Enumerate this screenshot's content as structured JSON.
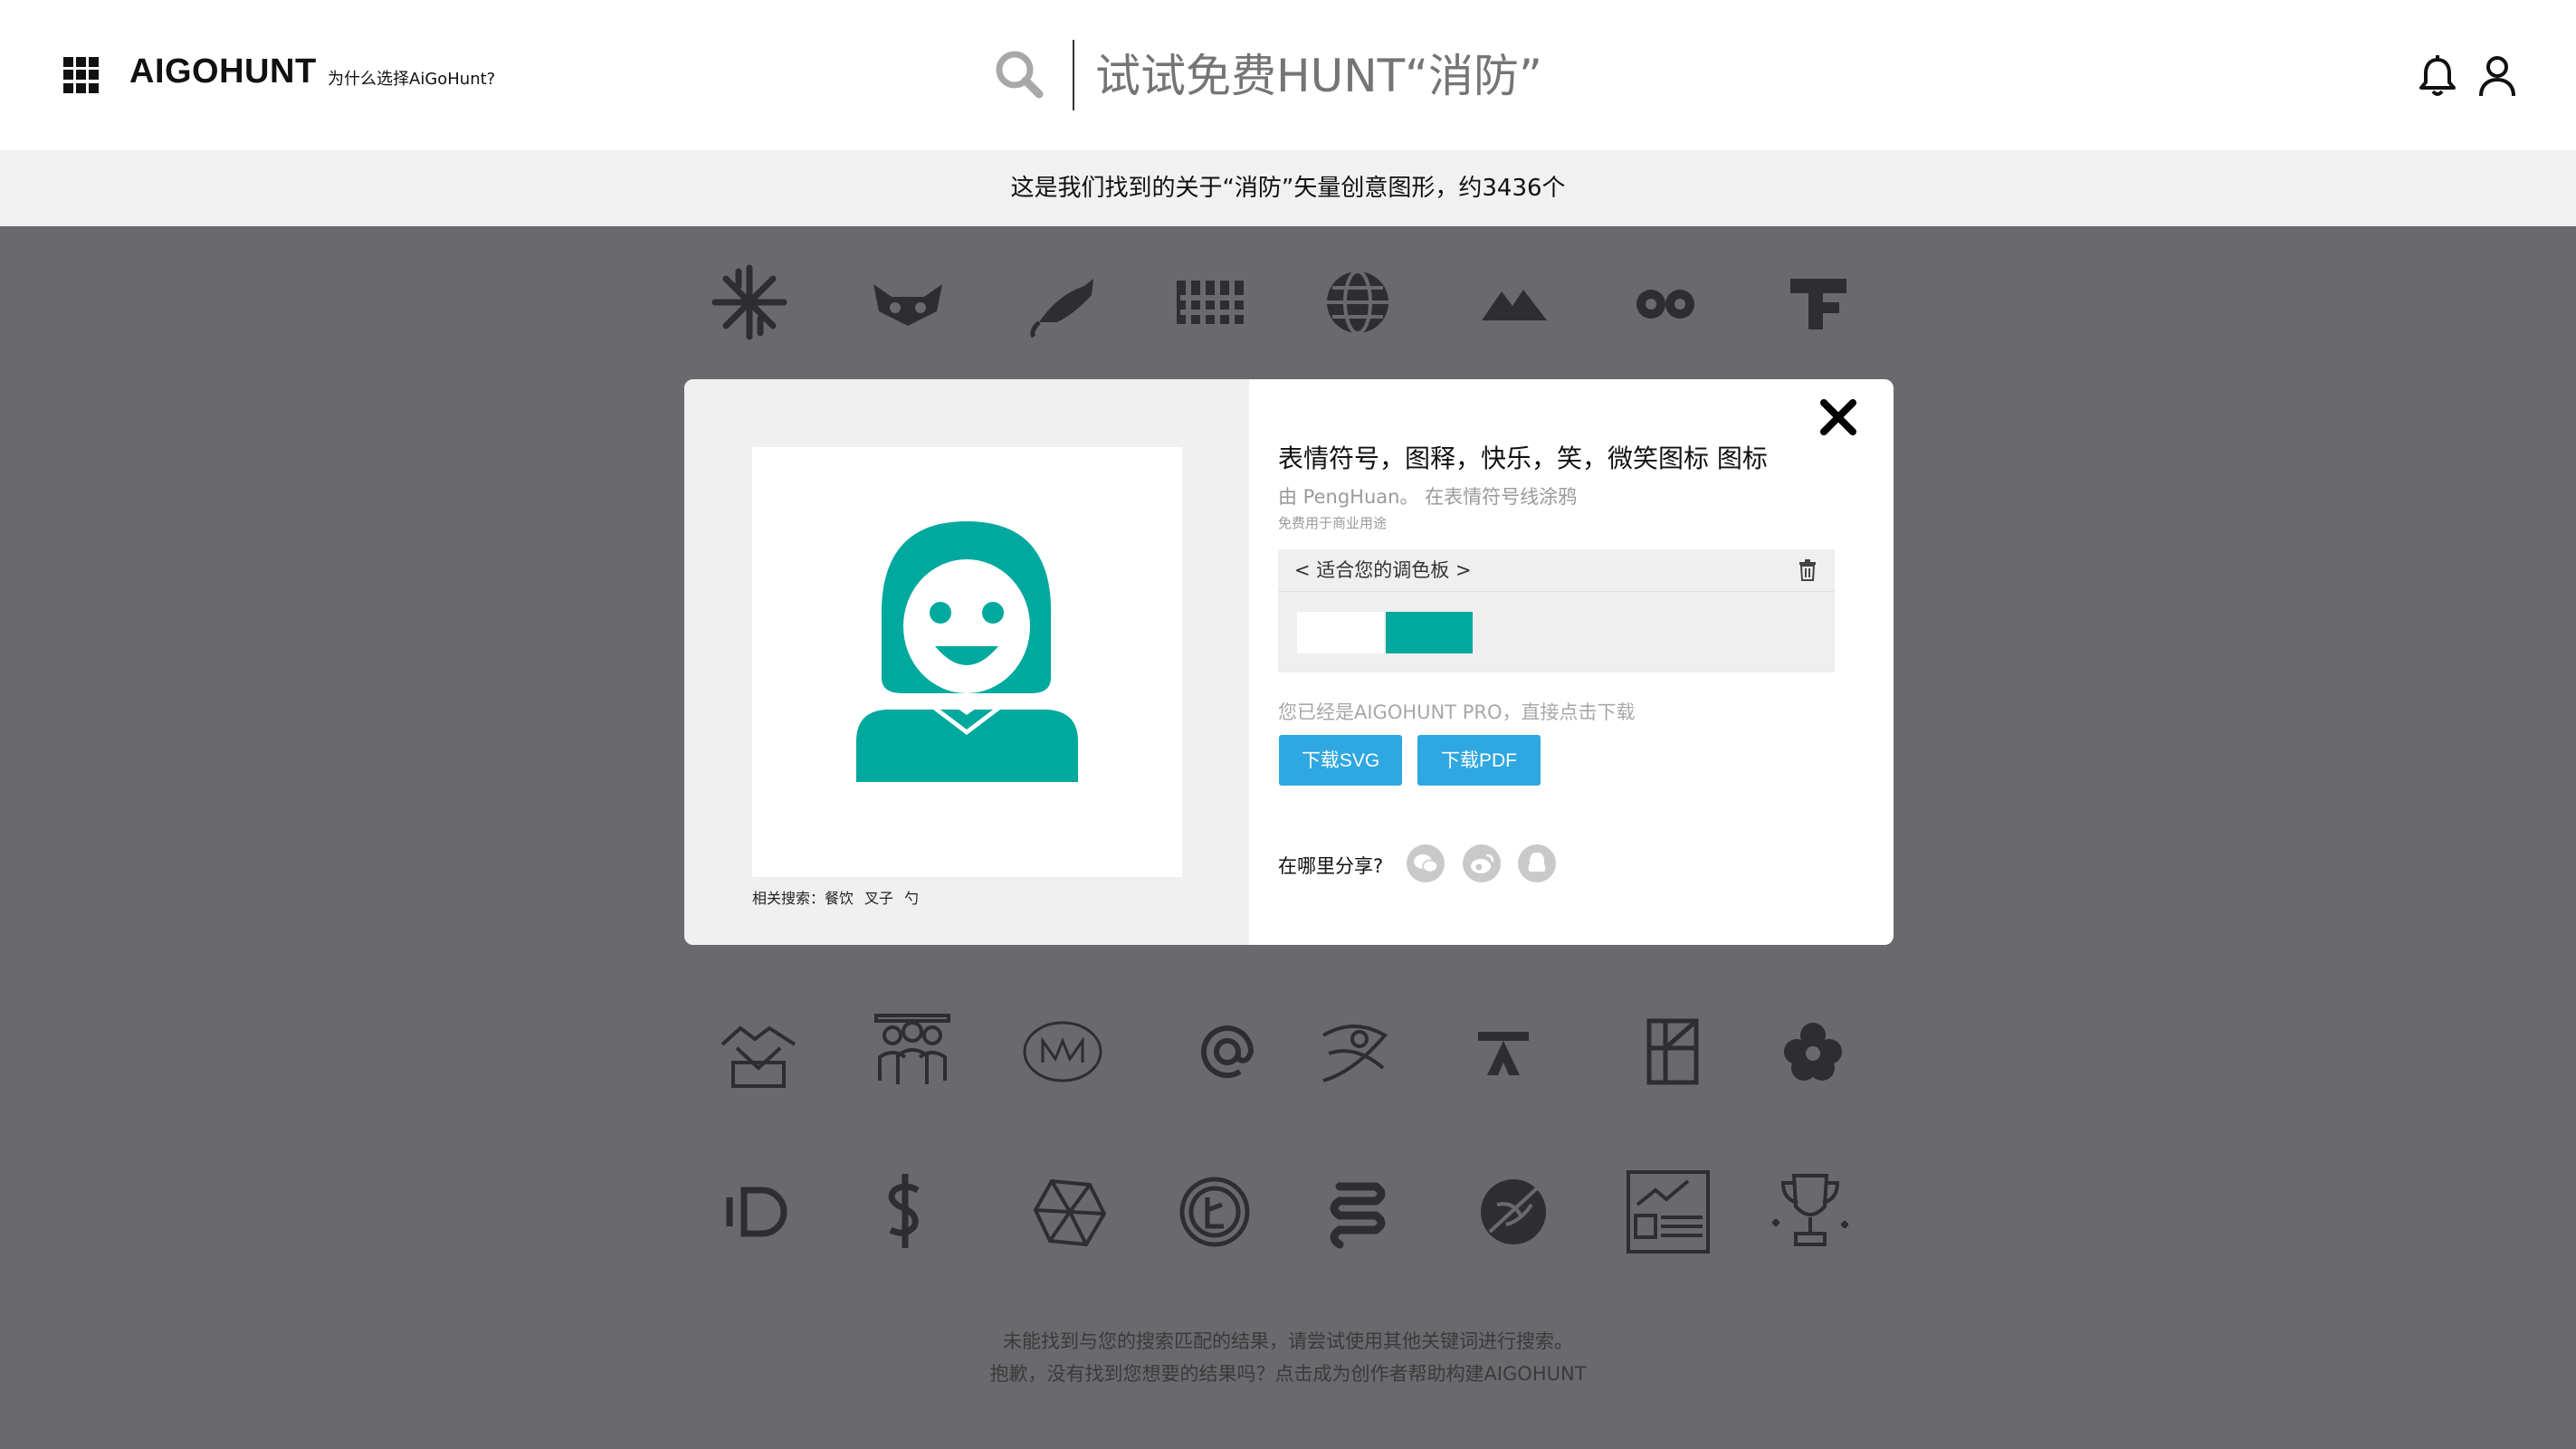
{
  "header": {
    "brand": "AIGOHUNT",
    "why_link": "为什么选择AiGoHunt?",
    "search_placeholder": "试试免费HUNT“消防”",
    "icons": [
      "grid-menu-icon",
      "search-icon",
      "bell-icon",
      "user-icon"
    ]
  },
  "results": {
    "summary": "这是我们找到的关于“消防”矢量创意图形，约3436个"
  },
  "icon_grid": {
    "row1": [
      "snowflake-pattern-icon",
      "raccoon-face-icon",
      "mouse-running-icon",
      "pixel-pattern-icon",
      "globe-icon",
      "mountain-icon",
      "eyes-logo-icon",
      "letter-f-icon"
    ],
    "row2": [
      "handshake-icon",
      "team-people-icon",
      "monogram-badge-icon",
      "at-sign-icon",
      "swirl-logo-icon",
      "letter-a-icon",
      "square-frame-icon",
      "flower-icon"
    ],
    "row3": [
      "letter-d-icon",
      "dollar-s-icon",
      "polygon-gem-icon",
      "coin-logo-icon",
      "coil-icon",
      "leaf-circle-icon",
      "newspaper-chart-icon",
      "trophy-icon"
    ]
  },
  "footer": {
    "line1": "未能找到与您的搜索匹配的结果，请尝试使用其他关键词进行搜索。",
    "line2": "抱歉，没有找到您想要的结果吗？点击成为创作者帮助构建AIGOHUNT"
  },
  "modal": {
    "title": "表情符号，图释，快乐，笑，微笑图标 图标",
    "byline": "由 PengHuan。 在表情符号线涂鸦",
    "license": "免费用于商业用途",
    "palette": {
      "name": "< 适合您的调色板 >",
      "colors": [
        "#ffffff",
        "#00a99d"
      ]
    },
    "pro_note": "您已经是AIGOHUNT PRO，直接点击下载",
    "download_svg": "下载SVG",
    "download_pdf": "下载PDF",
    "share_label": "在哪里分享?",
    "share_icons": [
      "wechat-icon",
      "weibo-icon",
      "qq-icon"
    ],
    "related_label": "相关搜索：",
    "related_terms": [
      "餐饮",
      "叉子",
      "勺"
    ],
    "preview_color": "#00a99d",
    "close_icon": "close-icon"
  }
}
